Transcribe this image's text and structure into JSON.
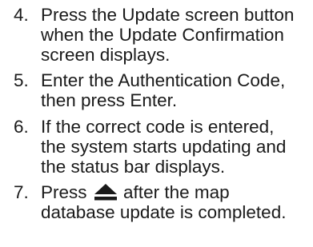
{
  "steps": [
    {
      "number": "4.",
      "lines": [
        "Press the Update screen button",
        "when the Update Confirmation",
        "screen displays."
      ]
    },
    {
      "number": "5.",
      "lines": [
        "Enter the Authentication Code,",
        "then press Enter."
      ]
    },
    {
      "number": "6.",
      "lines": [
        "If the correct code is entered,",
        "the system starts updating and",
        "the status bar displays."
      ]
    },
    {
      "number": "7.",
      "line1_before": "Press",
      "icon": "eject-icon",
      "line1_after": "after the map",
      "line2": "database update is completed."
    }
  ]
}
